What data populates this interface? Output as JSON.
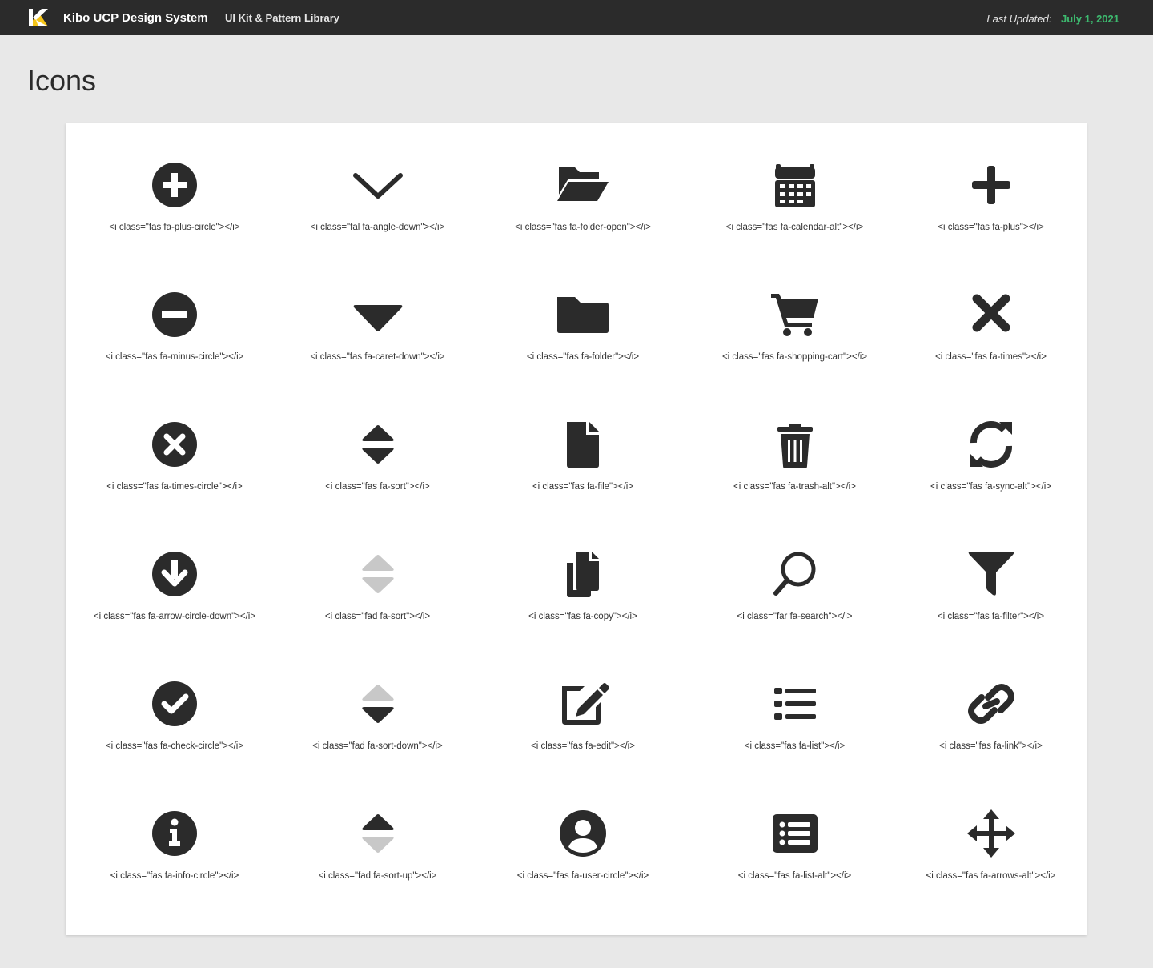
{
  "header": {
    "brand": "Kibo UCP Design System",
    "subtitle": "UI Kit & Pattern Library",
    "last_updated_label": "Last Updated:",
    "last_updated_date": "July 1, 2021"
  },
  "page": {
    "title": "Icons"
  },
  "colors": {
    "icon": "#2b2b2b",
    "icon_muted": "#c8c8c8",
    "accent_green": "#3dba6f",
    "logo_yellow": "#f5c518",
    "background": "#e8e8e8"
  },
  "icons": [
    {
      "name": "plus-circle-icon",
      "code": "<i class=\"fas fa-plus-circle\"></i>"
    },
    {
      "name": "angle-down-icon",
      "code": "<i class=\"fal fa-angle-down\"></i>"
    },
    {
      "name": "folder-open-icon",
      "code": "<i class=\"fas fa-folder-open\"></i>"
    },
    {
      "name": "calendar-alt-icon",
      "code": "<i class=\"fas fa-calendar-alt\"></i>"
    },
    {
      "name": "plus-icon",
      "code": "<i class=\"fas fa-plus\"></i>"
    },
    {
      "name": "minus-circle-icon",
      "code": "<i class=\"fas fa-minus-circle\"></i>"
    },
    {
      "name": "caret-down-icon",
      "code": "<i class=\"fas fa-caret-down\"></i>"
    },
    {
      "name": "folder-icon",
      "code": "<i class=\"fas fa-folder\"></i>"
    },
    {
      "name": "shopping-cart-icon",
      "code": "<i class=\"fas fa-shopping-cart\"></i>"
    },
    {
      "name": "times-icon",
      "code": "<i class=\"fas fa-times\"></i>"
    },
    {
      "name": "times-circle-icon",
      "code": "<i class=\"fas fa-times-circle\"></i>"
    },
    {
      "name": "sort-icon",
      "code": "<i class=\"fas fa-sort\"></i>"
    },
    {
      "name": "file-icon",
      "code": "<i class=\"fas fa-file\"></i>"
    },
    {
      "name": "trash-alt-icon",
      "code": "<i class=\"fas fa-trash-alt\"></i>"
    },
    {
      "name": "sync-alt-icon",
      "code": "<i class=\"fas fa-sync-alt\"></i>"
    },
    {
      "name": "arrow-circle-down-icon",
      "code": "<i class=\"fas fa-arrow-circle-down\"></i>"
    },
    {
      "name": "sort-duotone-icon",
      "code": "<i class=\"fad fa-sort\"></i>"
    },
    {
      "name": "copy-icon",
      "code": "<i class=\"fas fa-copy\"></i>"
    },
    {
      "name": "search-icon",
      "code": "<i class=\"far fa-search\"></i>"
    },
    {
      "name": "filter-icon",
      "code": "<i class=\"fas fa-filter\"></i>"
    },
    {
      "name": "check-circle-icon",
      "code": "<i class=\"fas fa-check-circle\"></i>"
    },
    {
      "name": "sort-down-duotone-icon",
      "code": "<i class=\"fad fa-sort-down\"></i>"
    },
    {
      "name": "edit-icon",
      "code": "<i class=\"fas fa-edit\"></i>"
    },
    {
      "name": "list-icon",
      "code": "<i class=\"fas fa-list\"></i>"
    },
    {
      "name": "link-icon",
      "code": "<i class=\"fas fa-link\"></i>"
    },
    {
      "name": "info-circle-icon",
      "code": "<i class=\"fas fa-info-circle\"></i>"
    },
    {
      "name": "sort-up-duotone-icon",
      "code": "<i class=\"fad fa-sort-up\"></i>"
    },
    {
      "name": "user-circle-icon",
      "code": "<i class=\"fas fa-user-circle\"></i>"
    },
    {
      "name": "list-alt-icon",
      "code": "<i class=\"fas fa-list-alt\"></i>"
    },
    {
      "name": "arrows-alt-icon",
      "code": "<i class=\"fas fa-arrows-alt\"></i>"
    }
  ]
}
